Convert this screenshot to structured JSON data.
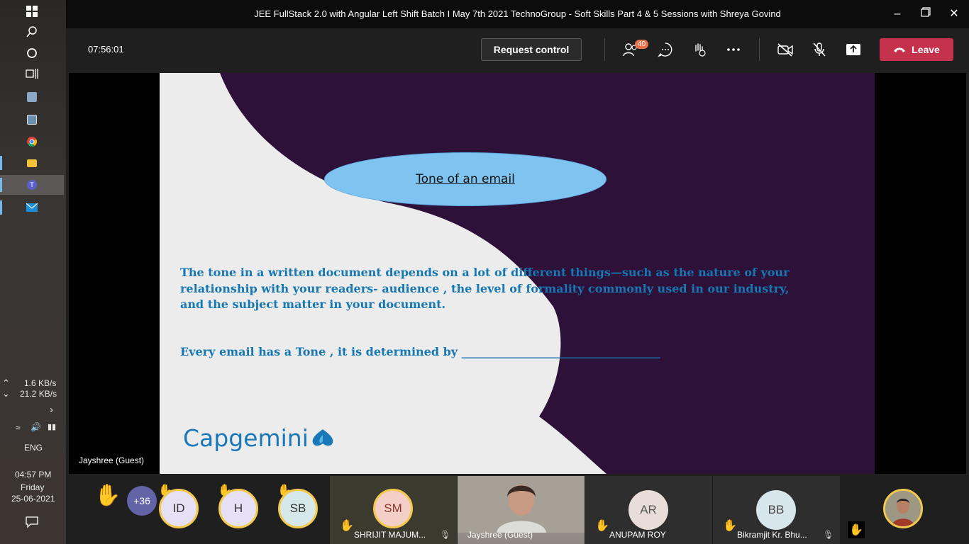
{
  "taskbar": {
    "net_up": "1.6 KB/s",
    "net_down": "21.2 KB/s",
    "lang": "ENG",
    "time": "04:57 PM",
    "day": "Friday",
    "date": "25-06-2021"
  },
  "window": {
    "title": "JEE FullStack 2.0 with Angular Left Shift Batch I May 7th 2021 TechnoGroup - Soft Skills Part 4 & 5 Sessions with Shreya Govind"
  },
  "toolbar": {
    "timer": "07:56:01",
    "request_control": "Request control",
    "participants_count": "40",
    "leave": "Leave"
  },
  "slide": {
    "ellipse_text": "Tone of an email",
    "paragraph": "The tone  in a written document depends on a lot of different things—such as the nature of your relationship with your readers- audience  , the level of formality commonly used in our industry, and the subject matter in your document.",
    "question": "Every email has a Tone , it is determined by ___________________________________",
    "logo": "Capgemini",
    "presenter_label": "Jayshree (Guest)"
  },
  "participants": {
    "more": "+36",
    "avatars": [
      "ID",
      "H",
      "SB"
    ],
    "tiles": [
      {
        "initials": "SM",
        "name": "SHRIJIT MAJUM..."
      },
      {
        "name": "Jayshree (Guest)"
      },
      {
        "initials": "AR",
        "name": "ANUPAM ROY"
      },
      {
        "initials": "BB",
        "name": "Bikramjit Kr. Bhu..."
      }
    ]
  }
}
